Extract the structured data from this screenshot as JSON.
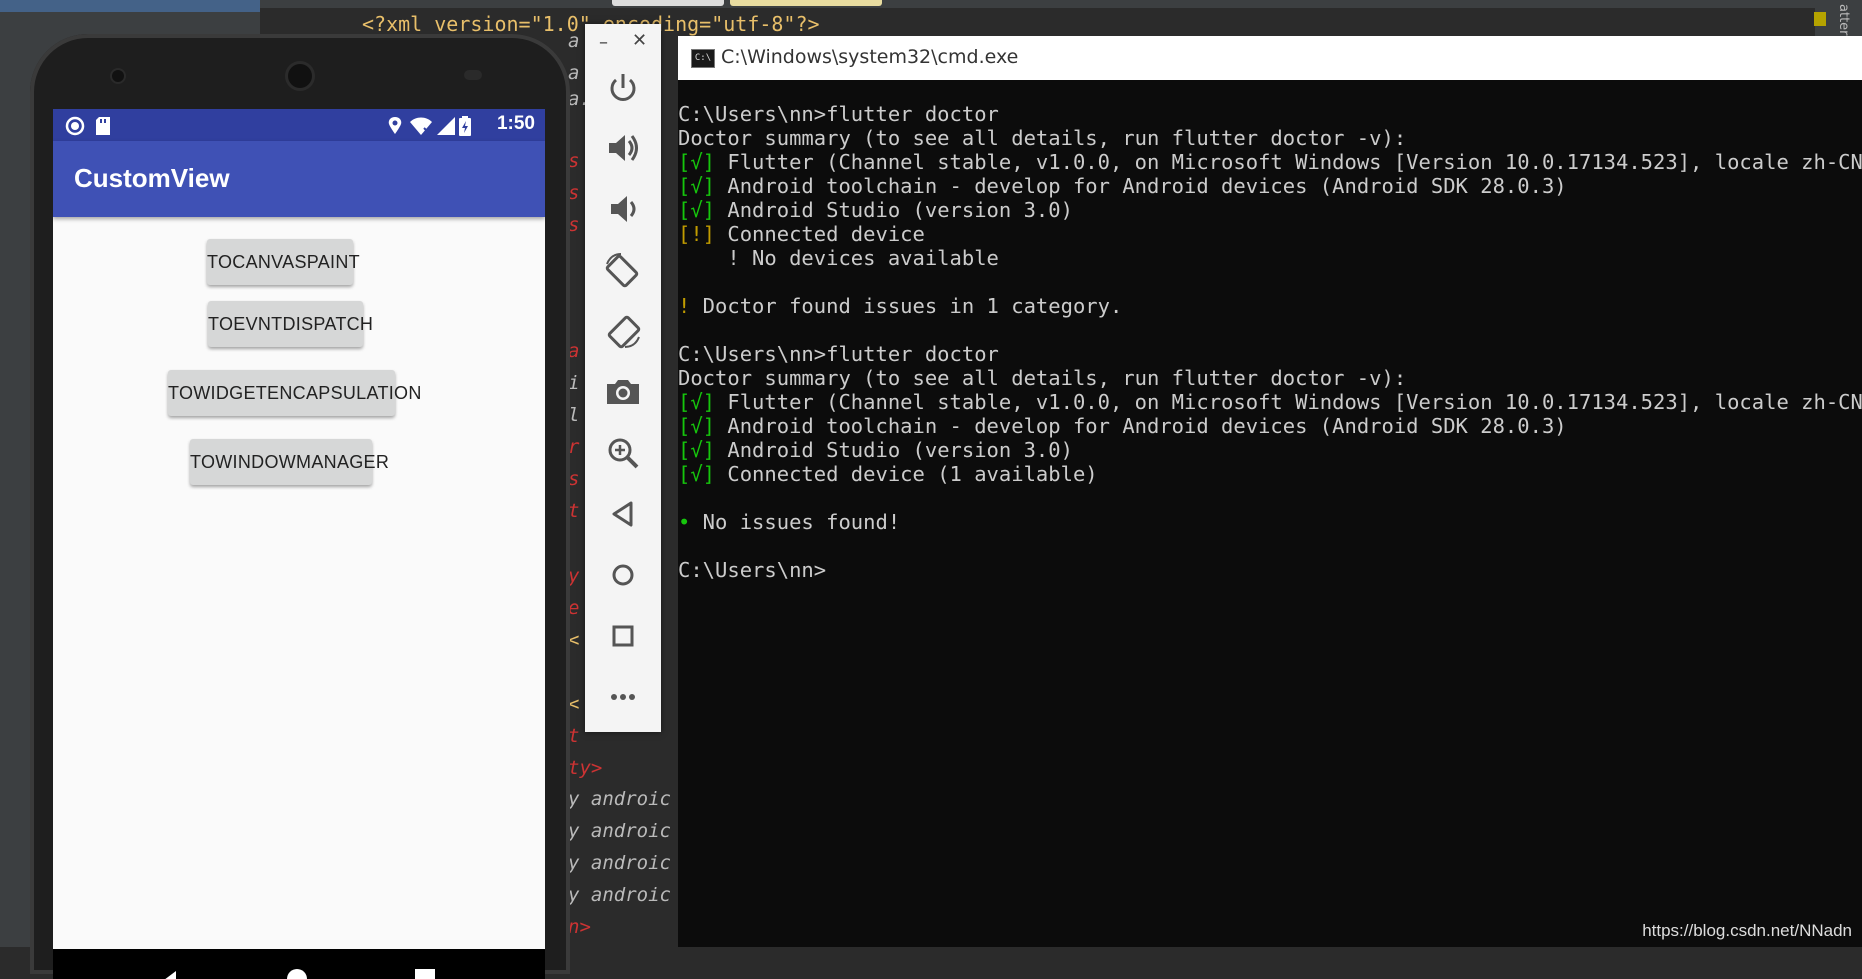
{
  "ide": {
    "xml_header_a": "<?xml version=\"1.0\" encoding=\"utf-8\"?>",
    "side_label": "atter",
    "strip_lines": [
      "a",
      "a",
      "a.",
      "s",
      "s",
      "s",
      "a",
      "i",
      "l",
      "r",
      "s",
      "t",
      "y",
      "e",
      "<",
      "<",
      "t",
      "ty>",
      "y androic",
      "y androic",
      "y androic",
      "y androic",
      "n>"
    ]
  },
  "phone": {
    "time": "1:50",
    "app_title": "CustomView",
    "buttons": [
      "TOCANVASPAINT",
      "TOEVNTDISPATCH",
      "TOWIDGETENCAPSULATION",
      "TOWINDOWMANAGER"
    ]
  },
  "emulator": {
    "min_label": "–",
    "close_label": "✕",
    "tools": [
      "power-icon",
      "volume-up-icon",
      "volume-down-icon",
      "rotate-left-icon",
      "rotate-right-icon",
      "camera-icon",
      "zoom-icon",
      "back-icon",
      "home-icon",
      "overview-icon",
      "more-icon"
    ]
  },
  "cmd": {
    "title": "C:\\Windows\\system32\\cmd.exe",
    "icon_text": "C:\\",
    "lines": [
      {
        "segments": [
          {
            "t": "C:\\Users\\nn>flutter doctor",
            "c": ""
          }
        ]
      },
      {
        "segments": [
          {
            "t": "Doctor summary (to see all details, run flutter doctor -v):",
            "c": ""
          }
        ]
      },
      {
        "segments": [
          {
            "t": "[√]",
            "c": "g"
          },
          {
            "t": " Flutter (Channel stable, v1.0.0, on Microsoft Windows [Version 10.0.17134.523], locale zh-CN)",
            "c": ""
          }
        ]
      },
      {
        "segments": [
          {
            "t": "[√]",
            "c": "g"
          },
          {
            "t": " Android toolchain - develop for Android devices (Android SDK 28.0.3)",
            "c": ""
          }
        ]
      },
      {
        "segments": [
          {
            "t": "[√]",
            "c": "g"
          },
          {
            "t": " Android Studio (version 3.0)",
            "c": ""
          }
        ]
      },
      {
        "segments": [
          {
            "t": "[!]",
            "c": "y"
          },
          {
            "t": " Connected device",
            "c": ""
          }
        ]
      },
      {
        "segments": [
          {
            "t": "    ! No devices available",
            "c": ""
          }
        ]
      },
      {
        "segments": [
          {
            "t": "",
            "c": ""
          }
        ]
      },
      {
        "segments": [
          {
            "t": "!",
            "c": "y"
          },
          {
            "t": " Doctor found issues in 1 category.",
            "c": ""
          }
        ]
      },
      {
        "segments": [
          {
            "t": "",
            "c": ""
          }
        ]
      },
      {
        "segments": [
          {
            "t": "C:\\Users\\nn>flutter doctor",
            "c": ""
          }
        ]
      },
      {
        "segments": [
          {
            "t": "Doctor summary (to see all details, run flutter doctor -v):",
            "c": ""
          }
        ]
      },
      {
        "segments": [
          {
            "t": "[√]",
            "c": "g"
          },
          {
            "t": " Flutter (Channel stable, v1.0.0, on Microsoft Windows [Version 10.0.17134.523], locale zh-CN)",
            "c": ""
          }
        ]
      },
      {
        "segments": [
          {
            "t": "[√]",
            "c": "g"
          },
          {
            "t": " Android toolchain - develop for Android devices (Android SDK 28.0.3)",
            "c": ""
          }
        ]
      },
      {
        "segments": [
          {
            "t": "[√]",
            "c": "g"
          },
          {
            "t": " Android Studio (version 3.0)",
            "c": ""
          }
        ]
      },
      {
        "segments": [
          {
            "t": "[√]",
            "c": "g"
          },
          {
            "t": " Connected device (1 available)",
            "c": ""
          }
        ]
      },
      {
        "segments": [
          {
            "t": "",
            "c": ""
          }
        ]
      },
      {
        "segments": [
          {
            "t": "•",
            "c": "g"
          },
          {
            "t": " No issues found!",
            "c": ""
          }
        ]
      },
      {
        "segments": [
          {
            "t": "",
            "c": ""
          }
        ]
      },
      {
        "segments": [
          {
            "t": "C:\\Users\\nn>",
            "c": ""
          }
        ]
      }
    ]
  },
  "watermark": "https://blog.csdn.net/NNadn"
}
